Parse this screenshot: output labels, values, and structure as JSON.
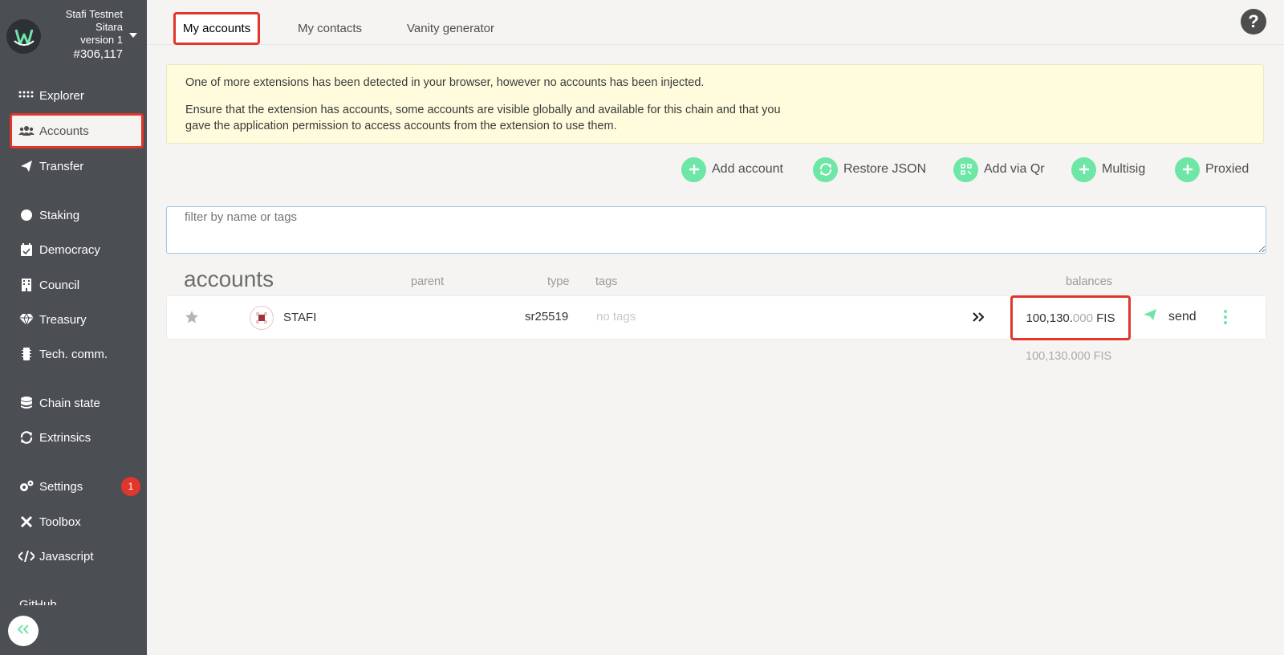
{
  "sidebar": {
    "chain": {
      "name_line1": "Stafi Testnet",
      "name_line2": "Sitara",
      "version": "version 1",
      "block": "#306,117"
    },
    "items": [
      {
        "label": "Explorer",
        "icon": "explorer-icon"
      },
      {
        "label": "Accounts",
        "icon": "users-icon",
        "active": true
      },
      {
        "label": "Transfer",
        "icon": "paper-plane-icon"
      },
      {
        "label": "Staking",
        "icon": "certificate-icon"
      },
      {
        "label": "Democracy",
        "icon": "calendar-check-icon"
      },
      {
        "label": "Council",
        "icon": "building-icon"
      },
      {
        "label": "Treasury",
        "icon": "gem-icon"
      },
      {
        "label": "Tech. comm.",
        "icon": "microchip-icon"
      },
      {
        "label": "Chain state",
        "icon": "database-icon"
      },
      {
        "label": "Extrinsics",
        "icon": "sync-icon"
      },
      {
        "label": "Settings",
        "icon": "cogs-icon"
      },
      {
        "label": "Toolbox",
        "icon": "tools-icon"
      },
      {
        "label": "Javascript",
        "icon": "code-icon"
      },
      {
        "label": "GitHub",
        "icon": "github-icon"
      }
    ],
    "settings_badge": "1"
  },
  "tabs": [
    {
      "label": "My accounts",
      "active": true
    },
    {
      "label": "My contacts"
    },
    {
      "label": "Vanity generator"
    }
  ],
  "help_icon": "?",
  "banner": {
    "line1": "One of more extensions has been detected in your browser, however no accounts has been injected.",
    "line2": "Ensure that the extension has accounts, some accounts are visible globally and available for this chain and that you gave the application permission to access accounts from the extension to use them."
  },
  "actions": [
    {
      "label": "Add account",
      "icon": "plus-icon"
    },
    {
      "label": "Restore JSON",
      "icon": "sync-icon"
    },
    {
      "label": "Add via Qr",
      "icon": "qrcode-icon"
    },
    {
      "label": "Multisig",
      "icon": "plus-icon"
    },
    {
      "label": "Proxied",
      "icon": "plus-icon"
    }
  ],
  "filter": {
    "placeholder": "filter by name or tags"
  },
  "table": {
    "title": "accounts",
    "headers": {
      "parent": "parent",
      "type": "type",
      "tags": "tags",
      "balances": "balances"
    },
    "rows": [
      {
        "name": "STAFI",
        "type": "sr25519",
        "tags": "no tags",
        "balance_int": "100,130.",
        "balance_dec": "000",
        "balance_unit": "FIS",
        "send_label": "send"
      }
    ],
    "total": {
      "int": "100,130.000",
      "unit": "FIS"
    }
  },
  "colors": {
    "accent": "#6ee6a6",
    "highlight": "#e0362b",
    "sidebar": "#4b4e53"
  }
}
